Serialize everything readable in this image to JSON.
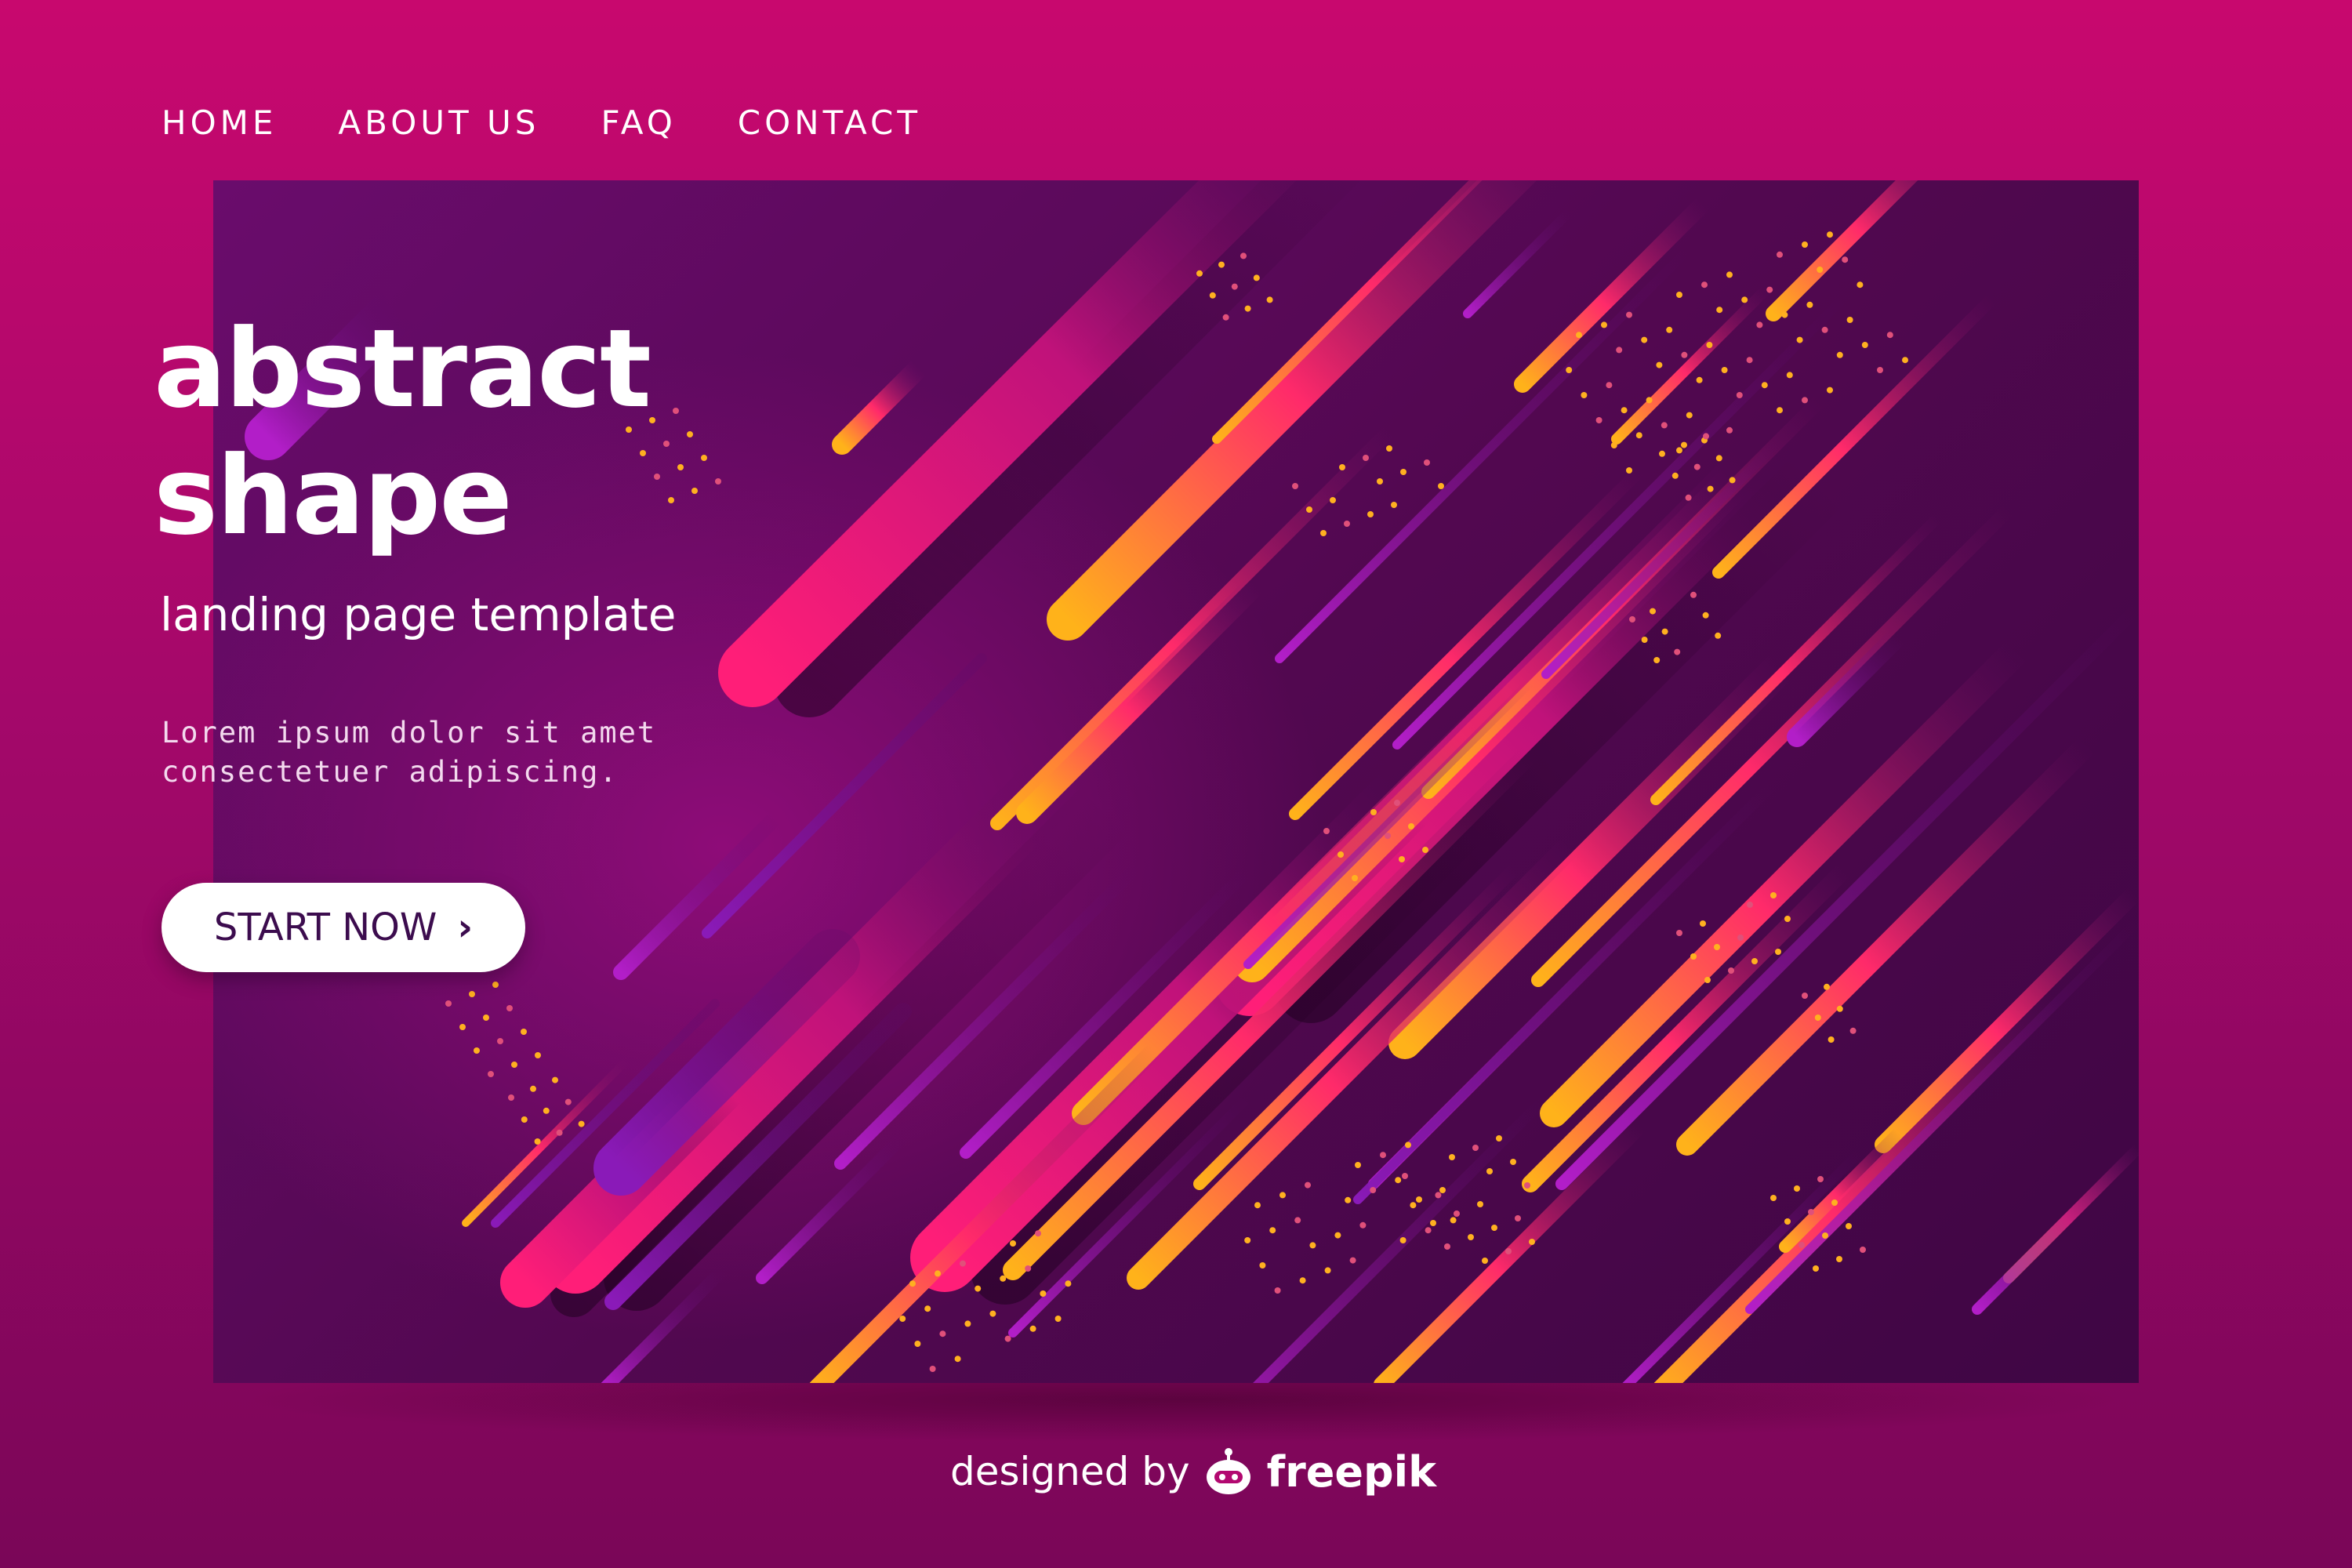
{
  "nav": {
    "items": [
      {
        "label": "HOME"
      },
      {
        "label": "ABOUT US"
      },
      {
        "label": "FAQ"
      },
      {
        "label": "CONTACT"
      }
    ]
  },
  "hero": {
    "title_line1": "abstract",
    "title_line2": "shape",
    "subtitle": "landing page template",
    "body_line1": "Lorem ipsum dolor sit amet",
    "body_line2": "consectetuer adipiscing.",
    "cta_label": "START NOW",
    "cta_icon": "chevron-right-icon"
  },
  "attribution": {
    "prefix": "designed by",
    "brand": "freepik",
    "logo_icon": "freepik-robot-icon"
  },
  "colors": {
    "page_background": "#c8086e",
    "frame_background": "#520850",
    "accent_orange": "#ffa81e",
    "accent_pink": "#ff1e6e",
    "accent_purple": "#b020c0",
    "cta_text": "#3c0c4e"
  }
}
